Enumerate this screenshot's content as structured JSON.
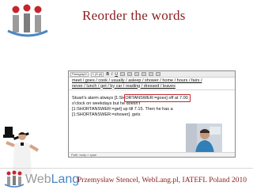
{
  "slide": {
    "title": "Reorder the words"
  },
  "editor": {
    "toolbar": {
      "style_select": "Paragraph",
      "size_select": "1 (8 pt)",
      "bold": "B",
      "italic": "I",
      "underline": "U"
    },
    "word_lines": [
      "meet / goes / cook / usually / asleep / shower / home / hours / fairs /",
      "never / lunch / get / by car / reading / dressed / leaves"
    ],
    "text_lines": [
      "Stuart's alarm always [1:SHORTANSWER:=goes] off at 7.00",
      "o'clock on weekdays but he doesn't",
      "[1:SHORTANSWER:=get] up till 7.15. Then he has a",
      "[1:SHORTANSWER:=shower]. gets"
    ],
    "path_label": "Path: body » span"
  },
  "footer": {
    "brand_web": "Web",
    "brand_lang": "Lang",
    "credit": "Przemysław Stencel, WebLang.pl, IATEFL Poland 2010"
  },
  "colors": {
    "title": "#8c1c1c",
    "highlight": "#c0282d",
    "brand_blue": "#4a86c5"
  }
}
